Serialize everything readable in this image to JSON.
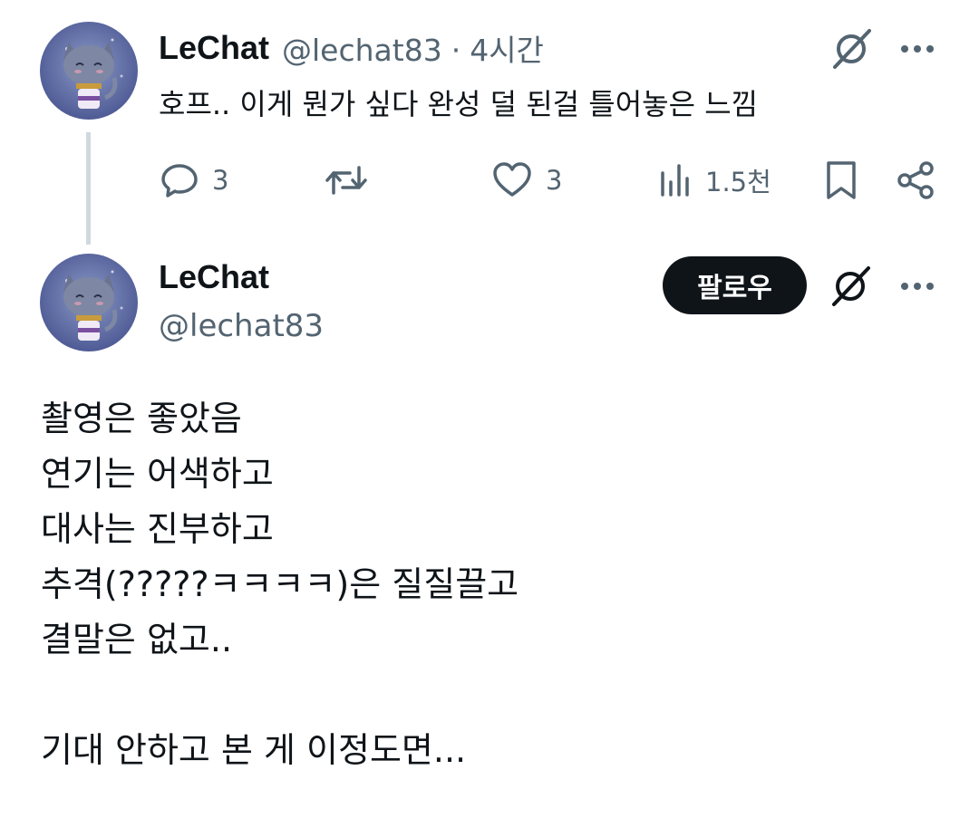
{
  "tweet1": {
    "avatar": "cat-avatar",
    "name": "LeChat",
    "handle": "@lechat83",
    "separator": "·",
    "time": "4시간",
    "text": "호프.. 이게 뭔가 싶다 완성 덜 된걸 틀어놓은 느낌",
    "actions": {
      "reply_count": "3",
      "retweet_count": "",
      "like_count": "3",
      "views_count": "1.5천"
    }
  },
  "tweet2": {
    "avatar": "cat-avatar",
    "name": "LeChat",
    "handle": "@lechat83",
    "follow_label": "팔로우",
    "lines": [
      "촬영은 좋았음",
      "연기는 어색하고",
      "대사는 진부하고",
      "추격(?????ㅋㅋㅋㅋ)은 질질끌고",
      "결말은 없고..",
      "",
      "기대 안하고 본 게 이정도면..."
    ]
  },
  "icons": [
    "grok-icon",
    "more-icon",
    "reply-icon",
    "retweet-icon",
    "like-icon",
    "views-icon",
    "bookmark-icon",
    "share-icon"
  ],
  "colors": {
    "text_primary": "#0f1419",
    "text_secondary": "#536471",
    "thread_line": "#cfd9de",
    "follow_bg": "#0f1419",
    "follow_text": "#ffffff"
  }
}
